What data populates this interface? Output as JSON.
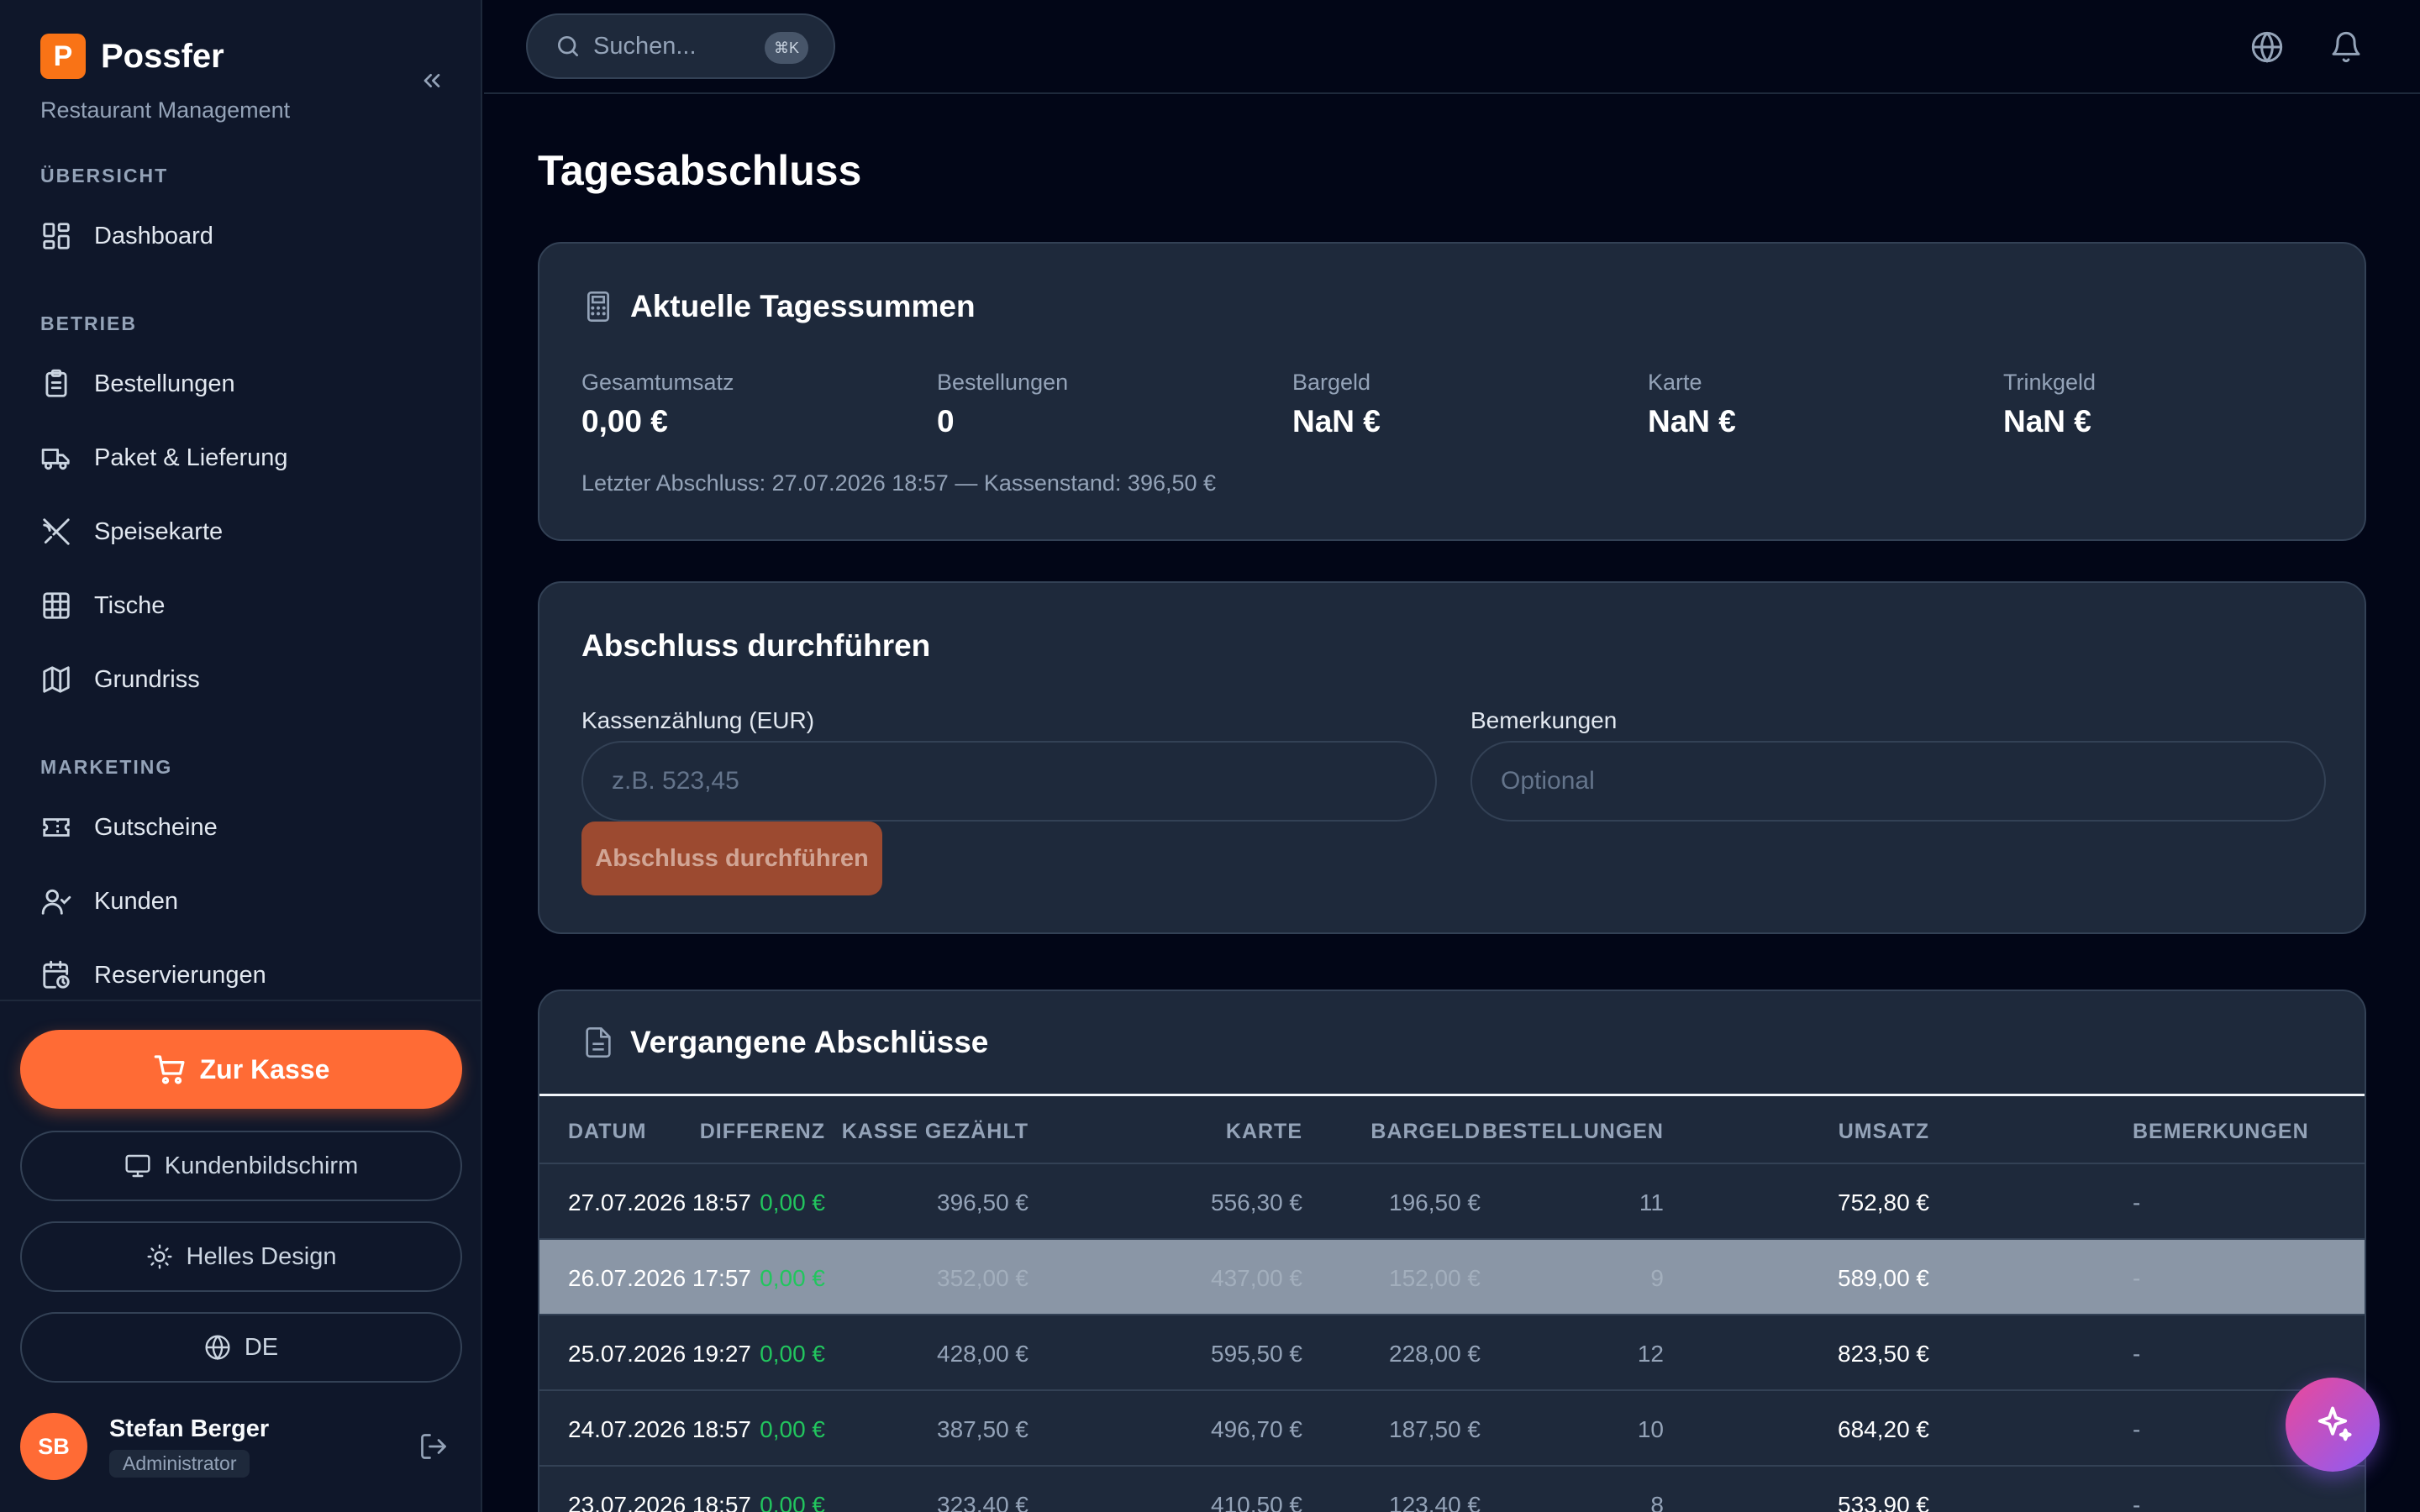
{
  "brand": {
    "logo_letter": "P",
    "name": "Possfer",
    "subtitle": "Restaurant Management"
  },
  "sidebar": {
    "sections": [
      {
        "label": "ÜBERSICHT",
        "items": [
          {
            "label": "Dashboard",
            "icon": "dashboard-icon"
          }
        ]
      },
      {
        "label": "BETRIEB",
        "items": [
          {
            "label": "Bestellungen",
            "icon": "clipboard-icon"
          },
          {
            "label": "Paket & Lieferung",
            "icon": "truck-icon"
          },
          {
            "label": "Speisekarte",
            "icon": "utensils-icon"
          },
          {
            "label": "Tische",
            "icon": "grid-icon"
          },
          {
            "label": "Grundriss",
            "icon": "map-icon"
          }
        ]
      },
      {
        "label": "MARKETING",
        "items": [
          {
            "label": "Gutscheine",
            "icon": "ticket-icon"
          },
          {
            "label": "Kunden",
            "icon": "user-check-icon"
          },
          {
            "label": "Reservierungen",
            "icon": "calendar-clock-icon"
          }
        ]
      }
    ],
    "pos_button": "Zur Kasse",
    "customer_display_button": "Kundenbildschirm",
    "theme_button": "Helles Design",
    "language_button": "DE",
    "user": {
      "initials": "SB",
      "name": "Stefan Berger",
      "role": "Administrator"
    }
  },
  "topbar": {
    "search_placeholder": "Suchen...",
    "shortcut": "⌘K"
  },
  "page": {
    "title": "Tagesabschluss"
  },
  "totals": {
    "title": "Aktuelle Tagessummen",
    "stats": [
      {
        "label": "Gesamtumsatz",
        "value": "0,00 €"
      },
      {
        "label": "Bestellungen",
        "value": "0"
      },
      {
        "label": "Bargeld",
        "value": "NaN €"
      },
      {
        "label": "Karte",
        "value": "NaN €"
      },
      {
        "label": "Trinkgeld",
        "value": "NaN €"
      }
    ],
    "last_close": "Letzter Abschluss: 27.07.2026 18:57 — Kassenstand: 396,50 €"
  },
  "close_form": {
    "title": "Abschluss durchführen",
    "cash_label": "Kassenzählung (EUR)",
    "cash_placeholder": "z.B. 523,45",
    "notes_label": "Bemerkungen",
    "notes_placeholder": "Optional",
    "submit": "Abschluss durchführen"
  },
  "history": {
    "title": "Vergangene Abschlüsse",
    "columns": [
      "DATUM",
      "UMSATZ",
      "BESTELLUNGEN",
      "BARGELD",
      "KARTE",
      "KASSE GEZÄHLT",
      "DIFFERENZ",
      "BEMERKUNGEN"
    ],
    "rows": [
      [
        "27.07.2026 18:57",
        "752,80 €",
        "11",
        "196,50 €",
        "556,30 €",
        "396,50 €",
        "0,00 €",
        "-"
      ],
      [
        "26.07.2026 17:57",
        "589,00 €",
        "9",
        "152,00 €",
        "437,00 €",
        "352,00 €",
        "0,00 €",
        "-"
      ],
      [
        "25.07.2026 19:27",
        "823,50 €",
        "12",
        "228,00 €",
        "595,50 €",
        "428,00 €",
        "0,00 €",
        "-"
      ],
      [
        "24.07.2026 18:57",
        "684,20 €",
        "10",
        "187,50 €",
        "496,70 €",
        "387,50 €",
        "0,00 €",
        "-"
      ],
      [
        "23.07.2026 18:57",
        "533,90 €",
        "8",
        "123,40 €",
        "410,50 €",
        "323,40 €",
        "0,00 €",
        "-"
      ]
    ]
  },
  "colors": {
    "accent": "#ff6b35",
    "background": "#020617",
    "card": "#1e293b",
    "positive": "#22c55e"
  }
}
